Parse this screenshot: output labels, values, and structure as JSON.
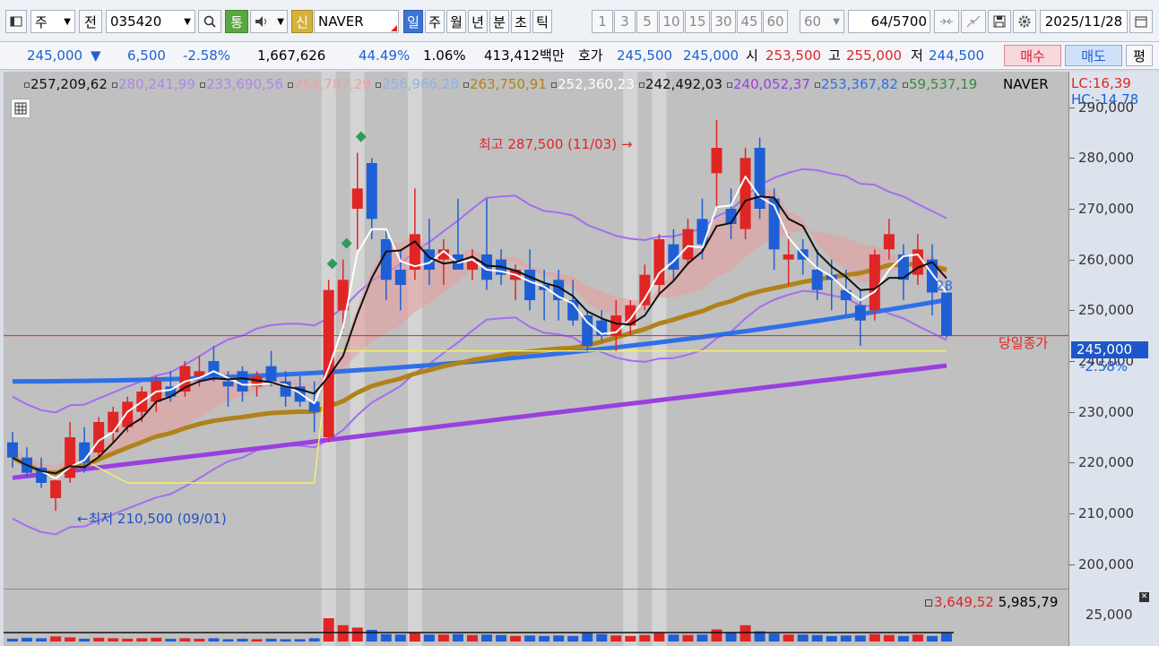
{
  "toolbar": {
    "period_unit": "주",
    "prefix_label": "전",
    "code": "035420",
    "search_icon": "search-icon",
    "tong_label": "통",
    "sound_icon": "speaker-icon",
    "shin_label": "신",
    "stock_name": "NAVER",
    "tabs": [
      "일",
      "주",
      "월",
      "년",
      "분",
      "초",
      "틱"
    ],
    "active_tab": "일",
    "intervals": [
      "1",
      "3",
      "5",
      "10",
      "15",
      "30",
      "45",
      "60"
    ],
    "interval_select": "60",
    "count": "64",
    "total": "/5700",
    "date": "2025/11/28"
  },
  "quote": {
    "price": "245,000",
    "down_arrow": "▼",
    "change": "6,500",
    "change_pct": "-2.58%",
    "volume": "1,667,626",
    "vol_pct": "44.49%",
    "turnover": "1.06%",
    "amount": "413,412백만",
    "hoga_label": "호가",
    "ask": "245,500",
    "bid": "245,000",
    "open_label": "시",
    "open": "253,500",
    "high_label": "고",
    "high": "255,000",
    "low_label": "저",
    "low": "244,500",
    "buy": "매수",
    "sell": "매도",
    "flat": "평"
  },
  "legend": {
    "values": [
      "257,209,62",
      "280,241,99",
      "233,690,56",
      "254,787,29",
      "256,966,28",
      "263,750,91",
      "252,360,23",
      "242,492,03",
      "240,052,37",
      "253,367,82",
      "59,537,19"
    ],
    "colors": [
      "#111111",
      "#a98ae6",
      "#a98ae6",
      "#f0a0a0",
      "#8fb3e6",
      "#b0821a",
      "#ffffff",
      "#111111",
      "#9a3fe0",
      "#2f6fe8",
      "#3a8a3a"
    ],
    "name": "NAVER",
    "lc": "LC:16,39",
    "hc": "HC:-14,78"
  },
  "annotations": {
    "high": "최고 287,500 (11/03) →",
    "low": "←최저 210,500 (09/01)",
    "close_label": "당일종가",
    "ma_tag": "28"
  },
  "axis": {
    "ticks": [
      "290,000",
      "280,000",
      "270,000",
      "260,000",
      "250,000",
      "240,000",
      "230,000",
      "220,000",
      "210,000",
      "200,000"
    ],
    "tick_values": [
      290000,
      280000,
      270000,
      260000,
      250000,
      240000,
      230000,
      220000,
      210000,
      200000
    ],
    "last_price": "245,000",
    "last_pct": "-2.58%",
    "vol_tick": "25,000"
  },
  "volume_legend": {
    "v1": "3,649,52",
    "v2": "5,985,79"
  },
  "chart_data": {
    "type": "candlestick",
    "ylim": [
      195000,
      297000
    ],
    "candles": [
      {
        "o": 224000,
        "h": 226000,
        "l": 219000,
        "c": 221000
      },
      {
        "o": 221000,
        "h": 223000,
        "l": 217000,
        "c": 218000
      },
      {
        "o": 219000,
        "h": 221000,
        "l": 215000,
        "c": 216000
      },
      {
        "o": 213000,
        "h": 217000,
        "l": 210500,
        "c": 216500
      },
      {
        "o": 217000,
        "h": 228000,
        "l": 216000,
        "c": 225000
      },
      {
        "o": 224000,
        "h": 227000,
        "l": 218000,
        "c": 220000
      },
      {
        "o": 222000,
        "h": 229000,
        "l": 221000,
        "c": 228000
      },
      {
        "o": 226000,
        "h": 231000,
        "l": 224000,
        "c": 230000
      },
      {
        "o": 227000,
        "h": 233000,
        "l": 226000,
        "c": 232000
      },
      {
        "o": 230000,
        "h": 235000,
        "l": 228000,
        "c": 234000
      },
      {
        "o": 232000,
        "h": 237000,
        "l": 230000,
        "c": 236000
      },
      {
        "o": 235000,
        "h": 238000,
        "l": 232000,
        "c": 233000
      },
      {
        "o": 234000,
        "h": 240000,
        "l": 233000,
        "c": 239000
      },
      {
        "o": 237000,
        "h": 241000,
        "l": 235000,
        "c": 238000
      },
      {
        "o": 240000,
        "h": 243000,
        "l": 236000,
        "c": 237000
      },
      {
        "o": 236000,
        "h": 238000,
        "l": 231000,
        "c": 235000
      },
      {
        "o": 238000,
        "h": 239000,
        "l": 232000,
        "c": 234000
      },
      {
        "o": 235000,
        "h": 238000,
        "l": 233000,
        "c": 237000
      },
      {
        "o": 239000,
        "h": 242000,
        "l": 235000,
        "c": 236000
      },
      {
        "o": 236000,
        "h": 238000,
        "l": 231000,
        "c": 233000
      },
      {
        "o": 235000,
        "h": 237000,
        "l": 231000,
        "c": 232000
      },
      {
        "o": 232000,
        "h": 236000,
        "l": 226000,
        "c": 230000
      },
      {
        "o": 225000,
        "h": 256000,
        "l": 224000,
        "c": 254000
      },
      {
        "o": 250000,
        "h": 260000,
        "l": 246000,
        "c": 256000
      },
      {
        "o": 270000,
        "h": 281000,
        "l": 262000,
        "c": 274000
      },
      {
        "o": 279000,
        "h": 280000,
        "l": 264000,
        "c": 268000
      },
      {
        "o": 264000,
        "h": 266000,
        "l": 252000,
        "c": 256000
      },
      {
        "o": 258000,
        "h": 262000,
        "l": 250000,
        "c": 255000
      },
      {
        "o": 258000,
        "h": 274000,
        "l": 256000,
        "c": 265000
      },
      {
        "o": 262000,
        "h": 268000,
        "l": 255000,
        "c": 258000
      },
      {
        "o": 260000,
        "h": 264000,
        "l": 255000,
        "c": 262000
      },
      {
        "o": 261000,
        "h": 272000,
        "l": 259000,
        "c": 258000
      },
      {
        "o": 258000,
        "h": 262000,
        "l": 256000,
        "c": 260000
      },
      {
        "o": 261000,
        "h": 272000,
        "l": 254000,
        "c": 256000
      },
      {
        "o": 260000,
        "h": 262000,
        "l": 255000,
        "c": 257000
      },
      {
        "o": 256000,
        "h": 259000,
        "l": 252000,
        "c": 258000
      },
      {
        "o": 258000,
        "h": 262000,
        "l": 250000,
        "c": 252000
      },
      {
        "o": 255000,
        "h": 258000,
        "l": 248000,
        "c": 254000
      },
      {
        "o": 256000,
        "h": 258000,
        "l": 248000,
        "c": 252000
      },
      {
        "o": 252000,
        "h": 256000,
        "l": 247000,
        "c": 248000
      },
      {
        "o": 249000,
        "h": 250000,
        "l": 242000,
        "c": 243000
      },
      {
        "o": 248000,
        "h": 250000,
        "l": 244000,
        "c": 245000
      },
      {
        "o": 245000,
        "h": 252000,
        "l": 242000,
        "c": 249000
      },
      {
        "o": 247000,
        "h": 252000,
        "l": 245000,
        "c": 251000
      },
      {
        "o": 251000,
        "h": 259000,
        "l": 250000,
        "c": 257000
      },
      {
        "o": 255000,
        "h": 265000,
        "l": 253000,
        "c": 264000
      },
      {
        "o": 263000,
        "h": 266000,
        "l": 256000,
        "c": 258000
      },
      {
        "o": 260000,
        "h": 268000,
        "l": 259000,
        "c": 266000
      },
      {
        "o": 268000,
        "h": 272000,
        "l": 260000,
        "c": 263000
      },
      {
        "o": 277000,
        "h": 287500,
        "l": 270000,
        "c": 282000
      },
      {
        "o": 270000,
        "h": 274000,
        "l": 264000,
        "c": 267000
      },
      {
        "o": 266000,
        "h": 282000,
        "l": 264000,
        "c": 280000
      },
      {
        "o": 282000,
        "h": 284000,
        "l": 268000,
        "c": 270000
      },
      {
        "o": 272000,
        "h": 274000,
        "l": 258000,
        "c": 262000
      },
      {
        "o": 260000,
        "h": 265000,
        "l": 255000,
        "c": 261000
      },
      {
        "o": 262000,
        "h": 264000,
        "l": 257000,
        "c": 260000
      },
      {
        "o": 258000,
        "h": 262000,
        "l": 252000,
        "c": 254000
      },
      {
        "o": 257000,
        "h": 260000,
        "l": 250000,
        "c": 256000
      },
      {
        "o": 254000,
        "h": 258000,
        "l": 249000,
        "c": 252000
      },
      {
        "o": 251000,
        "h": 254000,
        "l": 243000,
        "c": 248000
      },
      {
        "o": 250000,
        "h": 262000,
        "l": 248000,
        "c": 261000
      },
      {
        "o": 262000,
        "h": 268000,
        "l": 260000,
        "c": 265000
      },
      {
        "o": 261000,
        "h": 263000,
        "l": 252000,
        "c": 256000
      },
      {
        "o": 257000,
        "h": 265000,
        "l": 255000,
        "c": 262000
      },
      {
        "o": 260000,
        "h": 263000,
        "l": 249000,
        "c": 253500
      },
      {
        "o": 253500,
        "h": 255000,
        "l": 244500,
        "c": 245000
      }
    ],
    "close_line": 245000,
    "volumes": [
      60,
      80,
      70,
      110,
      90,
      60,
      80,
      70,
      60,
      70,
      80,
      60,
      70,
      60,
      70,
      50,
      60,
      50,
      60,
      50,
      50,
      70,
      500,
      350,
      300,
      250,
      160,
      150,
      200,
      150,
      150,
      160,
      140,
      150,
      140,
      120,
      130,
      120,
      130,
      120,
      180,
      160,
      130,
      120,
      140,
      180,
      150,
      140,
      150,
      260,
      190,
      350,
      220,
      170,
      150,
      150,
      140,
      120,
      130,
      130,
      160,
      140,
      120,
      150,
      120,
      180
    ]
  }
}
